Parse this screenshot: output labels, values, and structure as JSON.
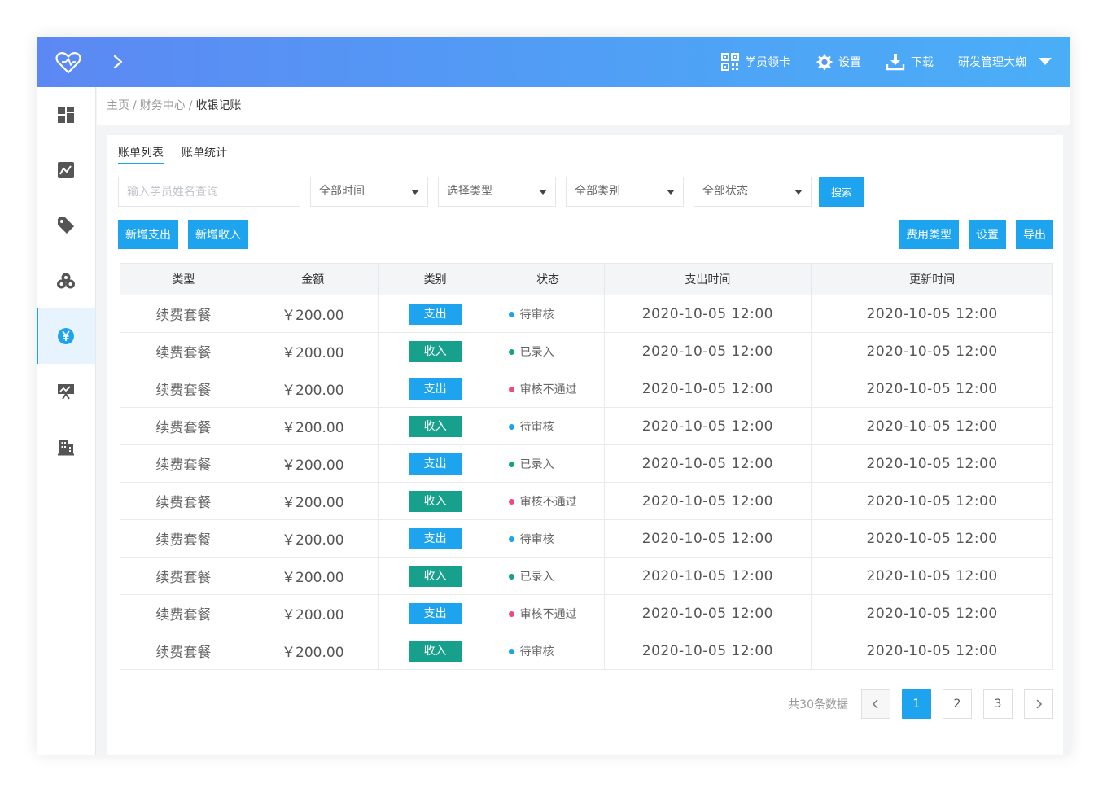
{
  "header": {
    "items": [
      {
        "label": "学员领卡",
        "icon": "qrcode-icon"
      },
      {
        "label": "设置",
        "icon": "gear-icon"
      },
      {
        "label": "下载",
        "icon": "download-icon"
      }
    ],
    "user": "研发管理大蜘"
  },
  "sidebar": {
    "items": [
      {
        "icon": "dashboard-icon"
      },
      {
        "icon": "chart-icon"
      },
      {
        "icon": "tag-icon"
      },
      {
        "icon": "coins-icon"
      },
      {
        "icon": "yen-circle-icon",
        "active": true
      },
      {
        "icon": "presentation-icon"
      },
      {
        "icon": "building-icon"
      }
    ]
  },
  "breadcrumb": {
    "home": "主页",
    "section": "财务中心",
    "current": "收银记账"
  },
  "tabs": [
    {
      "label": "账单列表",
      "active": true
    },
    {
      "label": "账单统计"
    }
  ],
  "filters": {
    "search_placeholder": "输入学员姓名查询",
    "time": "全部时间",
    "type": "选择类型",
    "category": "全部类别",
    "status": "全部状态",
    "search_button": "搜索"
  },
  "actions": {
    "add_expense": "新增支出",
    "add_income": "新增收入",
    "fee_type": "费用类型",
    "settings": "设置",
    "export": "导出"
  },
  "table": {
    "headers": [
      "类型",
      "金额",
      "类别",
      "状态",
      "支出时间",
      "更新时间"
    ],
    "rows": [
      {
        "type": "续费套餐",
        "amount": "￥200.00",
        "category": "支出",
        "status": "待审核",
        "spend_time": "2020-10-05  12:00",
        "update_time": "2020-10-05  12:00"
      },
      {
        "type": "续费套餐",
        "amount": "￥200.00",
        "category": "收入",
        "status": "已录入",
        "spend_time": "2020-10-05  12:00",
        "update_time": "2020-10-05  12:00"
      },
      {
        "type": "续费套餐",
        "amount": "￥200.00",
        "category": "支出",
        "status": "审核不通过",
        "spend_time": "2020-10-05  12:00",
        "update_time": "2020-10-05  12:00"
      },
      {
        "type": "续费套餐",
        "amount": "￥200.00",
        "category": "收入",
        "status": "待审核",
        "spend_time": "2020-10-05  12:00",
        "update_time": "2020-10-05  12:00"
      },
      {
        "type": "续费套餐",
        "amount": "￥200.00",
        "category": "支出",
        "status": "已录入",
        "spend_time": "2020-10-05  12:00",
        "update_time": "2020-10-05  12:00"
      },
      {
        "type": "续费套餐",
        "amount": "￥200.00",
        "category": "收入",
        "status": "审核不通过",
        "spend_time": "2020-10-05  12:00",
        "update_time": "2020-10-05  12:00"
      },
      {
        "type": "续费套餐",
        "amount": "￥200.00",
        "category": "支出",
        "status": "待审核",
        "spend_time": "2020-10-05  12:00",
        "update_time": "2020-10-05  12:00"
      },
      {
        "type": "续费套餐",
        "amount": "￥200.00",
        "category": "收入",
        "status": "已录入",
        "spend_time": "2020-10-05  12:00",
        "update_time": "2020-10-05  12:00"
      },
      {
        "type": "续费套餐",
        "amount": "￥200.00",
        "category": "支出",
        "status": "审核不通过",
        "spend_time": "2020-10-05  12:00",
        "update_time": "2020-10-05  12:00"
      },
      {
        "type": "续费套餐",
        "amount": "￥200.00",
        "category": "收入",
        "status": "待审核",
        "spend_time": "2020-10-05  12:00",
        "update_time": "2020-10-05  12:00"
      }
    ]
  },
  "pagination": {
    "total": "共30条数据",
    "pages": [
      "1",
      "2",
      "3"
    ],
    "current": "1"
  },
  "colors": {
    "accent": "#1ea4ef",
    "income": "#17a08b",
    "pending_dot": "#1ea4ef",
    "entered_dot": "#17a08b",
    "rejected_dot": "#f0468a"
  }
}
